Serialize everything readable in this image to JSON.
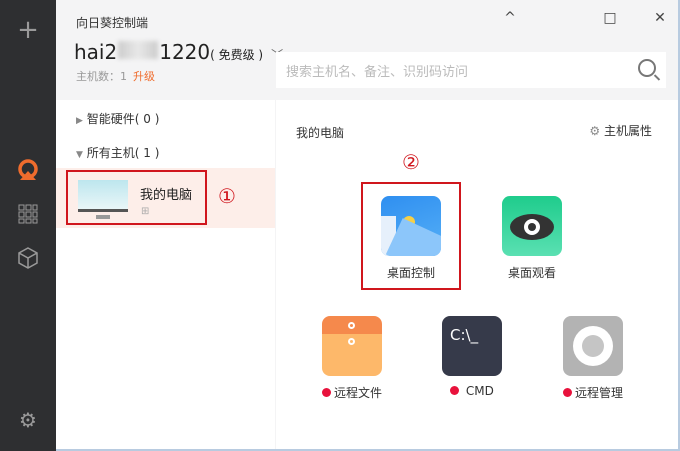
{
  "window": {
    "title": "向日葵控制端",
    "minimize": "^",
    "maximize": "□",
    "close": "✕"
  },
  "account": {
    "user_prefix": "hai2",
    "user_suffix": "1220",
    "tier": "( 免费级 )",
    "host_count": "主机数：1",
    "upgrade": "升级"
  },
  "search": {
    "placeholder": "搜索主机名、备注、识别码访问"
  },
  "tree": {
    "groups": [
      {
        "label": "智能硬件( 0 )"
      },
      {
        "label": "所有主机( 1 )"
      }
    ],
    "host": {
      "name": "我的电脑",
      "os_icon": "windows-icon"
    },
    "annotation": "①"
  },
  "panel": {
    "title": "我的电脑",
    "properties": "主机属性",
    "annotation": "②",
    "apps": [
      {
        "label": "桌面控制"
      },
      {
        "label": "桌面观看"
      },
      {
        "label": "远程文件"
      },
      {
        "label": "CMD",
        "icon_text": "C:\\_"
      },
      {
        "label": "远程管理"
      }
    ]
  },
  "colors": {
    "accent": "#ef6c2d",
    "highlight": "#d0161d"
  }
}
